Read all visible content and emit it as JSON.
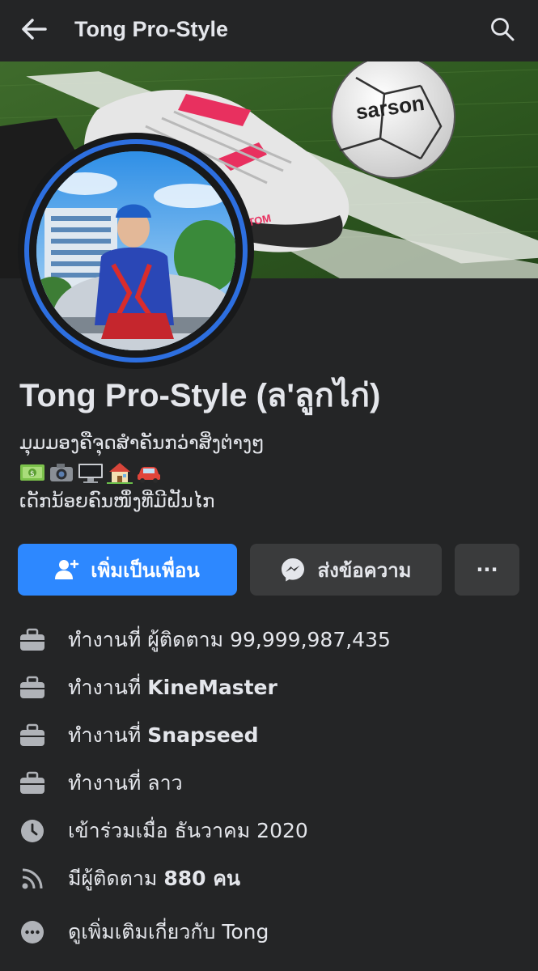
{
  "header": {
    "title": "Tong Pro-Style",
    "back_icon": "arrow-left-icon",
    "search_icon": "search-icon"
  },
  "cover": {
    "ball_brand": "sarson",
    "shoe_text": "PHANTOM"
  },
  "profile": {
    "name": "Tong Pro-Style (ล'ลูกไก่)",
    "bio_line1": "ມຸມມອງຄືຈຸດສຳຄັນກວ່າສິ່ງຕ່າງໆ",
    "bio_emojis": [
      "money-emoji",
      "camera-emoji",
      "computer-emoji",
      "house-emoji",
      "car-emoji"
    ],
    "bio_line3": "ເດັກນ້ອຍຄົນໜຶ່ງທີ່ມີຝັນໄກ"
  },
  "actions": {
    "add_friend_label": "เพิ่มเป็นเพื่อน",
    "message_label": "ส่งข้อความ",
    "more_label": "···"
  },
  "info": [
    {
      "icon": "briefcase-icon",
      "prefix": "ทำงานที่ ",
      "value": "ผู้ติดตาม 99,999,987,435",
      "bold": false
    },
    {
      "icon": "briefcase-icon",
      "prefix": "ทำงานที่ ",
      "value": "KineMaster",
      "bold": true
    },
    {
      "icon": "briefcase-icon",
      "prefix": "ทำงานที่ ",
      "value": "Snapseed",
      "bold": true
    },
    {
      "icon": "briefcase-icon",
      "prefix": "ทำงานที่ ",
      "value": "ลาว",
      "bold": false
    },
    {
      "icon": "clock-icon",
      "prefix": "เข้าร่วมเมื่อ ",
      "value": "ธันวาคม  2020",
      "bold": false
    },
    {
      "icon": "rss-icon",
      "prefix": "มีผู้ติดตาม ",
      "value": "880 คน",
      "bold": true
    },
    {
      "icon": "more-dots-icon",
      "prefix": "ดูเพิ่มเติมเกี่ยวกับ ",
      "value": "Tong",
      "bold": false
    }
  ],
  "colors": {
    "background": "#242526",
    "primary": "#2d88ff",
    "secondary_button": "#3a3b3c",
    "text": "#e4e6eb",
    "icon": "#b0b3b8"
  }
}
